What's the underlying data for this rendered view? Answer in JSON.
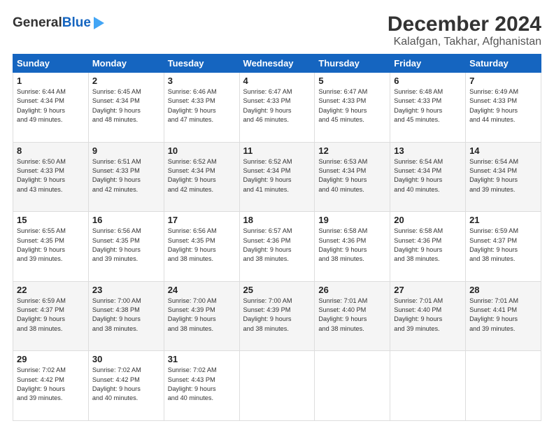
{
  "header": {
    "logo_general": "General",
    "logo_blue": "Blue",
    "title": "December 2024",
    "subtitle": "Kalafgan, Takhar, Afghanistan"
  },
  "calendar": {
    "days_of_week": [
      "Sunday",
      "Monday",
      "Tuesday",
      "Wednesday",
      "Thursday",
      "Friday",
      "Saturday"
    ],
    "weeks": [
      [
        {
          "day": "1",
          "info": "Sunrise: 6:44 AM\nSunset: 4:34 PM\nDaylight: 9 hours\nand 49 minutes."
        },
        {
          "day": "2",
          "info": "Sunrise: 6:45 AM\nSunset: 4:34 PM\nDaylight: 9 hours\nand 48 minutes."
        },
        {
          "day": "3",
          "info": "Sunrise: 6:46 AM\nSunset: 4:33 PM\nDaylight: 9 hours\nand 47 minutes."
        },
        {
          "day": "4",
          "info": "Sunrise: 6:47 AM\nSunset: 4:33 PM\nDaylight: 9 hours\nand 46 minutes."
        },
        {
          "day": "5",
          "info": "Sunrise: 6:47 AM\nSunset: 4:33 PM\nDaylight: 9 hours\nand 45 minutes."
        },
        {
          "day": "6",
          "info": "Sunrise: 6:48 AM\nSunset: 4:33 PM\nDaylight: 9 hours\nand 45 minutes."
        },
        {
          "day": "7",
          "info": "Sunrise: 6:49 AM\nSunset: 4:33 PM\nDaylight: 9 hours\nand 44 minutes."
        }
      ],
      [
        {
          "day": "8",
          "info": "Sunrise: 6:50 AM\nSunset: 4:33 PM\nDaylight: 9 hours\nand 43 minutes."
        },
        {
          "day": "9",
          "info": "Sunrise: 6:51 AM\nSunset: 4:33 PM\nDaylight: 9 hours\nand 42 minutes."
        },
        {
          "day": "10",
          "info": "Sunrise: 6:52 AM\nSunset: 4:34 PM\nDaylight: 9 hours\nand 42 minutes."
        },
        {
          "day": "11",
          "info": "Sunrise: 6:52 AM\nSunset: 4:34 PM\nDaylight: 9 hours\nand 41 minutes."
        },
        {
          "day": "12",
          "info": "Sunrise: 6:53 AM\nSunset: 4:34 PM\nDaylight: 9 hours\nand 40 minutes."
        },
        {
          "day": "13",
          "info": "Sunrise: 6:54 AM\nSunset: 4:34 PM\nDaylight: 9 hours\nand 40 minutes."
        },
        {
          "day": "14",
          "info": "Sunrise: 6:54 AM\nSunset: 4:34 PM\nDaylight: 9 hours\nand 39 minutes."
        }
      ],
      [
        {
          "day": "15",
          "info": "Sunrise: 6:55 AM\nSunset: 4:35 PM\nDaylight: 9 hours\nand 39 minutes."
        },
        {
          "day": "16",
          "info": "Sunrise: 6:56 AM\nSunset: 4:35 PM\nDaylight: 9 hours\nand 39 minutes."
        },
        {
          "day": "17",
          "info": "Sunrise: 6:56 AM\nSunset: 4:35 PM\nDaylight: 9 hours\nand 38 minutes."
        },
        {
          "day": "18",
          "info": "Sunrise: 6:57 AM\nSunset: 4:36 PM\nDaylight: 9 hours\nand 38 minutes."
        },
        {
          "day": "19",
          "info": "Sunrise: 6:58 AM\nSunset: 4:36 PM\nDaylight: 9 hours\nand 38 minutes."
        },
        {
          "day": "20",
          "info": "Sunrise: 6:58 AM\nSunset: 4:36 PM\nDaylight: 9 hours\nand 38 minutes."
        },
        {
          "day": "21",
          "info": "Sunrise: 6:59 AM\nSunset: 4:37 PM\nDaylight: 9 hours\nand 38 minutes."
        }
      ],
      [
        {
          "day": "22",
          "info": "Sunrise: 6:59 AM\nSunset: 4:37 PM\nDaylight: 9 hours\nand 38 minutes."
        },
        {
          "day": "23",
          "info": "Sunrise: 7:00 AM\nSunset: 4:38 PM\nDaylight: 9 hours\nand 38 minutes."
        },
        {
          "day": "24",
          "info": "Sunrise: 7:00 AM\nSunset: 4:39 PM\nDaylight: 9 hours\nand 38 minutes."
        },
        {
          "day": "25",
          "info": "Sunrise: 7:00 AM\nSunset: 4:39 PM\nDaylight: 9 hours\nand 38 minutes."
        },
        {
          "day": "26",
          "info": "Sunrise: 7:01 AM\nSunset: 4:40 PM\nDaylight: 9 hours\nand 38 minutes."
        },
        {
          "day": "27",
          "info": "Sunrise: 7:01 AM\nSunset: 4:40 PM\nDaylight: 9 hours\nand 39 minutes."
        },
        {
          "day": "28",
          "info": "Sunrise: 7:01 AM\nSunset: 4:41 PM\nDaylight: 9 hours\nand 39 minutes."
        }
      ],
      [
        {
          "day": "29",
          "info": "Sunrise: 7:02 AM\nSunset: 4:42 PM\nDaylight: 9 hours\nand 39 minutes."
        },
        {
          "day": "30",
          "info": "Sunrise: 7:02 AM\nSunset: 4:42 PM\nDaylight: 9 hours\nand 40 minutes."
        },
        {
          "day": "31",
          "info": "Sunrise: 7:02 AM\nSunset: 4:43 PM\nDaylight: 9 hours\nand 40 minutes."
        },
        {
          "day": "",
          "info": ""
        },
        {
          "day": "",
          "info": ""
        },
        {
          "day": "",
          "info": ""
        },
        {
          "day": "",
          "info": ""
        }
      ]
    ]
  }
}
